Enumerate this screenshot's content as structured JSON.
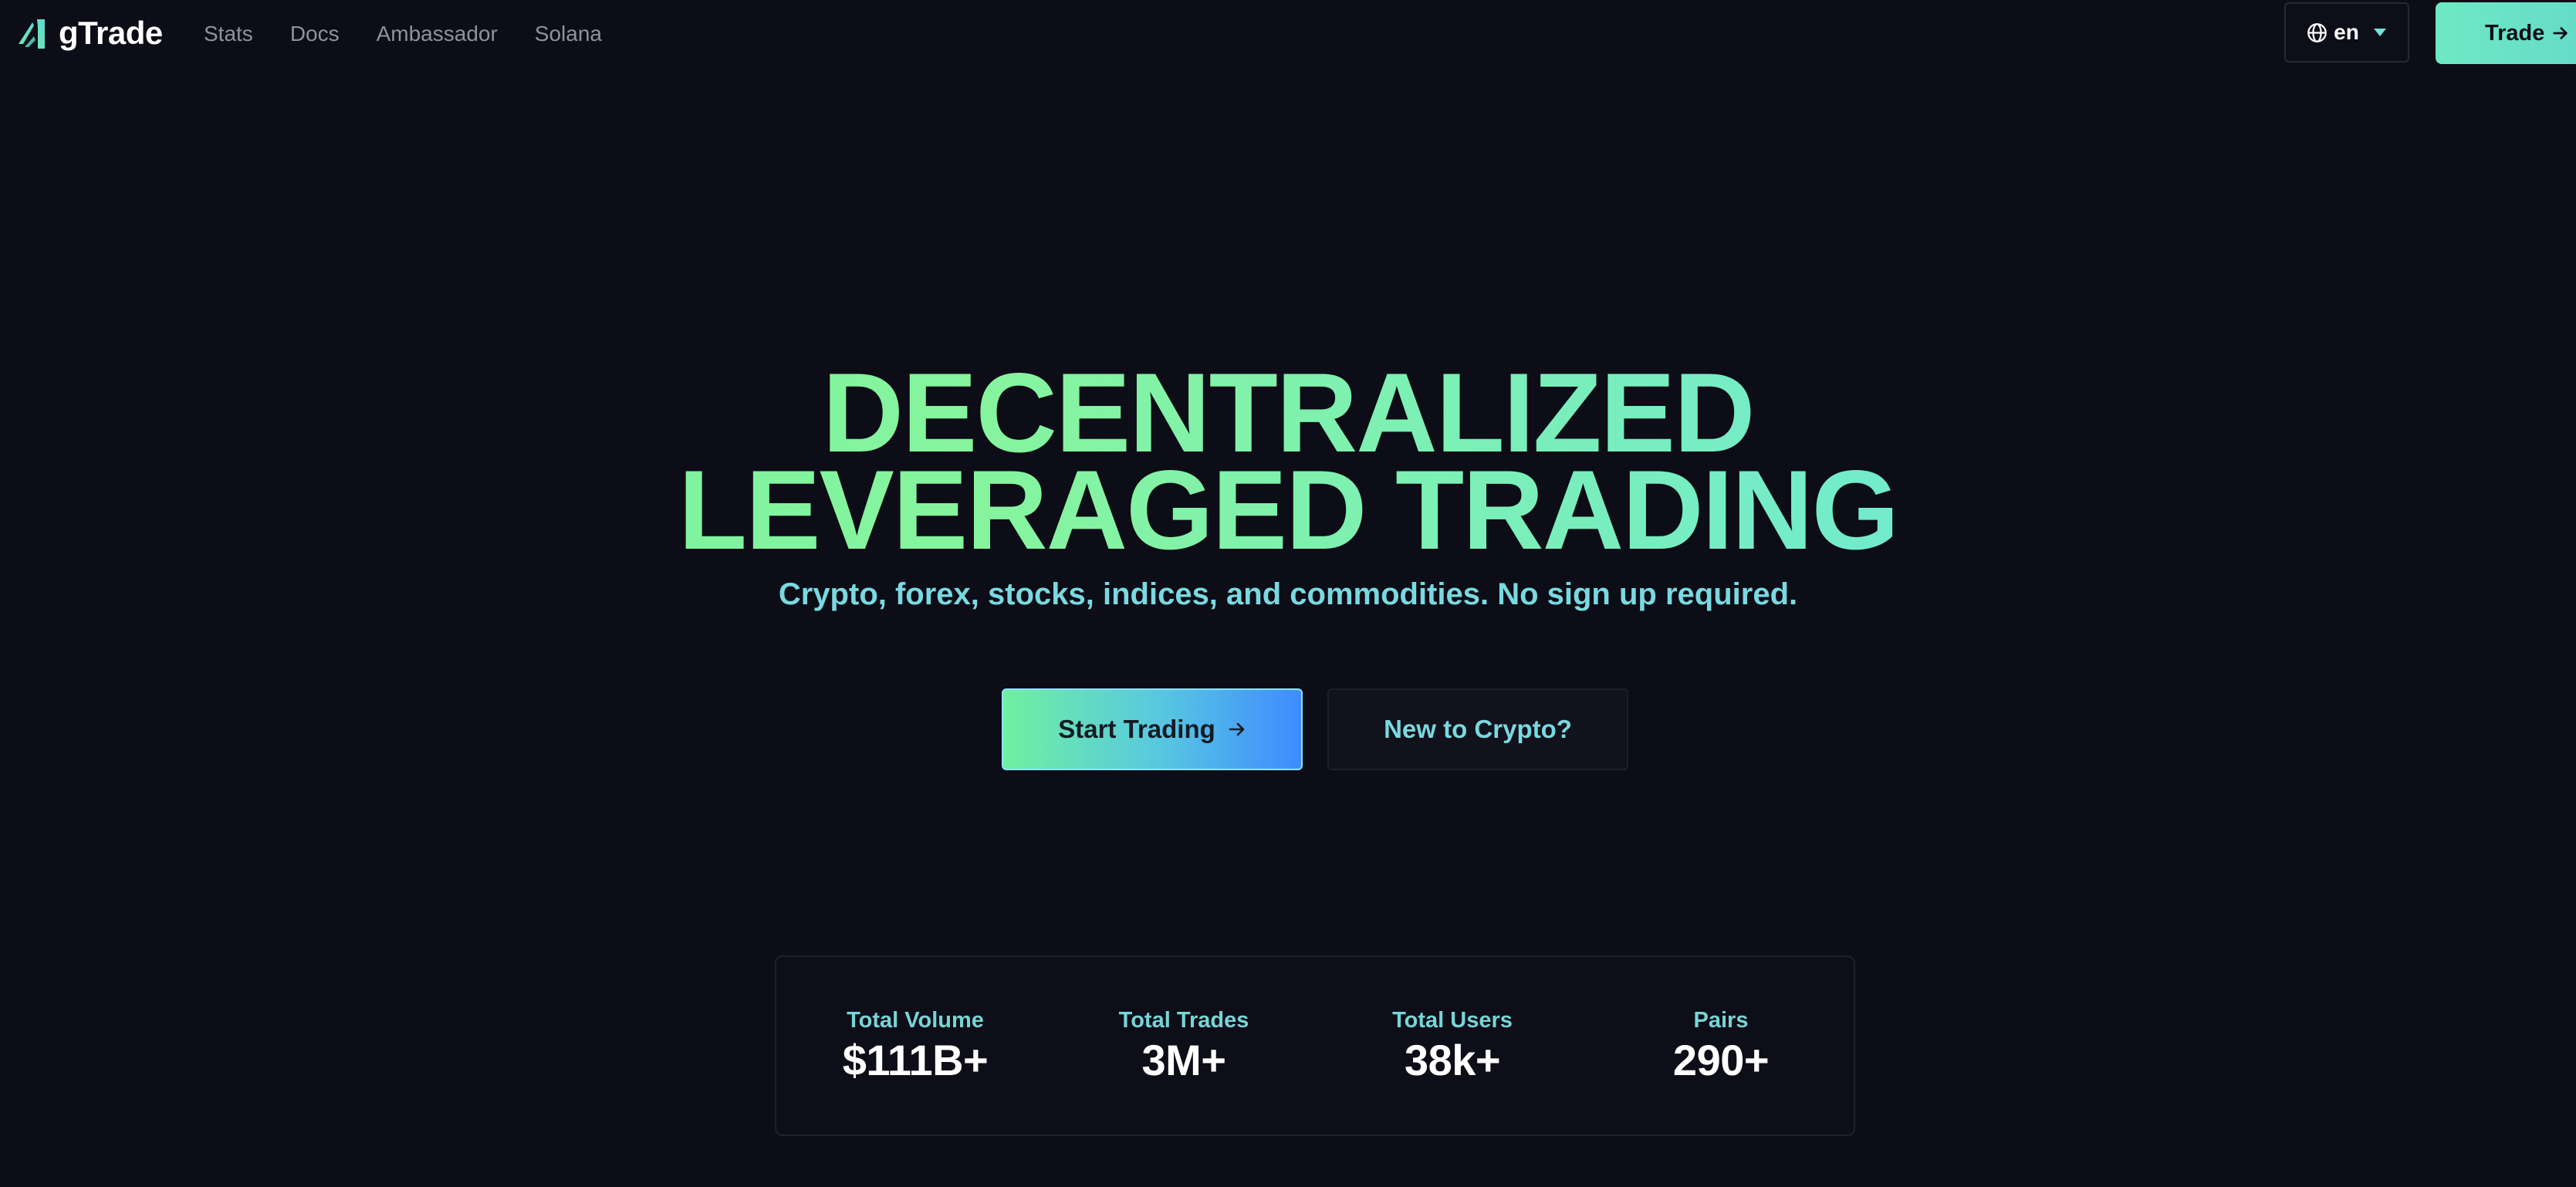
{
  "header": {
    "logo_text": "gTrade",
    "nav": [
      "Stats",
      "Docs",
      "Ambassador",
      "Solana"
    ],
    "language": "en",
    "trade_label": "Trade"
  },
  "hero": {
    "title_line1": "DECENTRALIZED",
    "title_line2": "LEVERAGED TRADING",
    "subtitle": "Crypto, forex, stocks, indices, and commodities. No sign up required."
  },
  "cta": {
    "primary_label": "Start Trading",
    "secondary_label": "New to Crypto?"
  },
  "stats": [
    {
      "label": "Total Volume",
      "value": "$111B+"
    },
    {
      "label": "Total Trades",
      "value": "3M+"
    },
    {
      "label": "Total Users",
      "value": "38k+"
    },
    {
      "label": "Pairs",
      "value": "290+"
    }
  ],
  "colors": {
    "background": "#0c0d16",
    "accent_green": "#72f1a3",
    "accent_cyan": "#62e1e6",
    "accent_blue": "#3e8bff",
    "subtitle_text": "#7ad9e0",
    "nav_text": "#8e929d"
  },
  "icons": {
    "logo": "gtrade-logo-icon",
    "language": "globe-icon",
    "dropdown": "caret-down-icon",
    "cta_arrow": "arrow-right-icon"
  }
}
